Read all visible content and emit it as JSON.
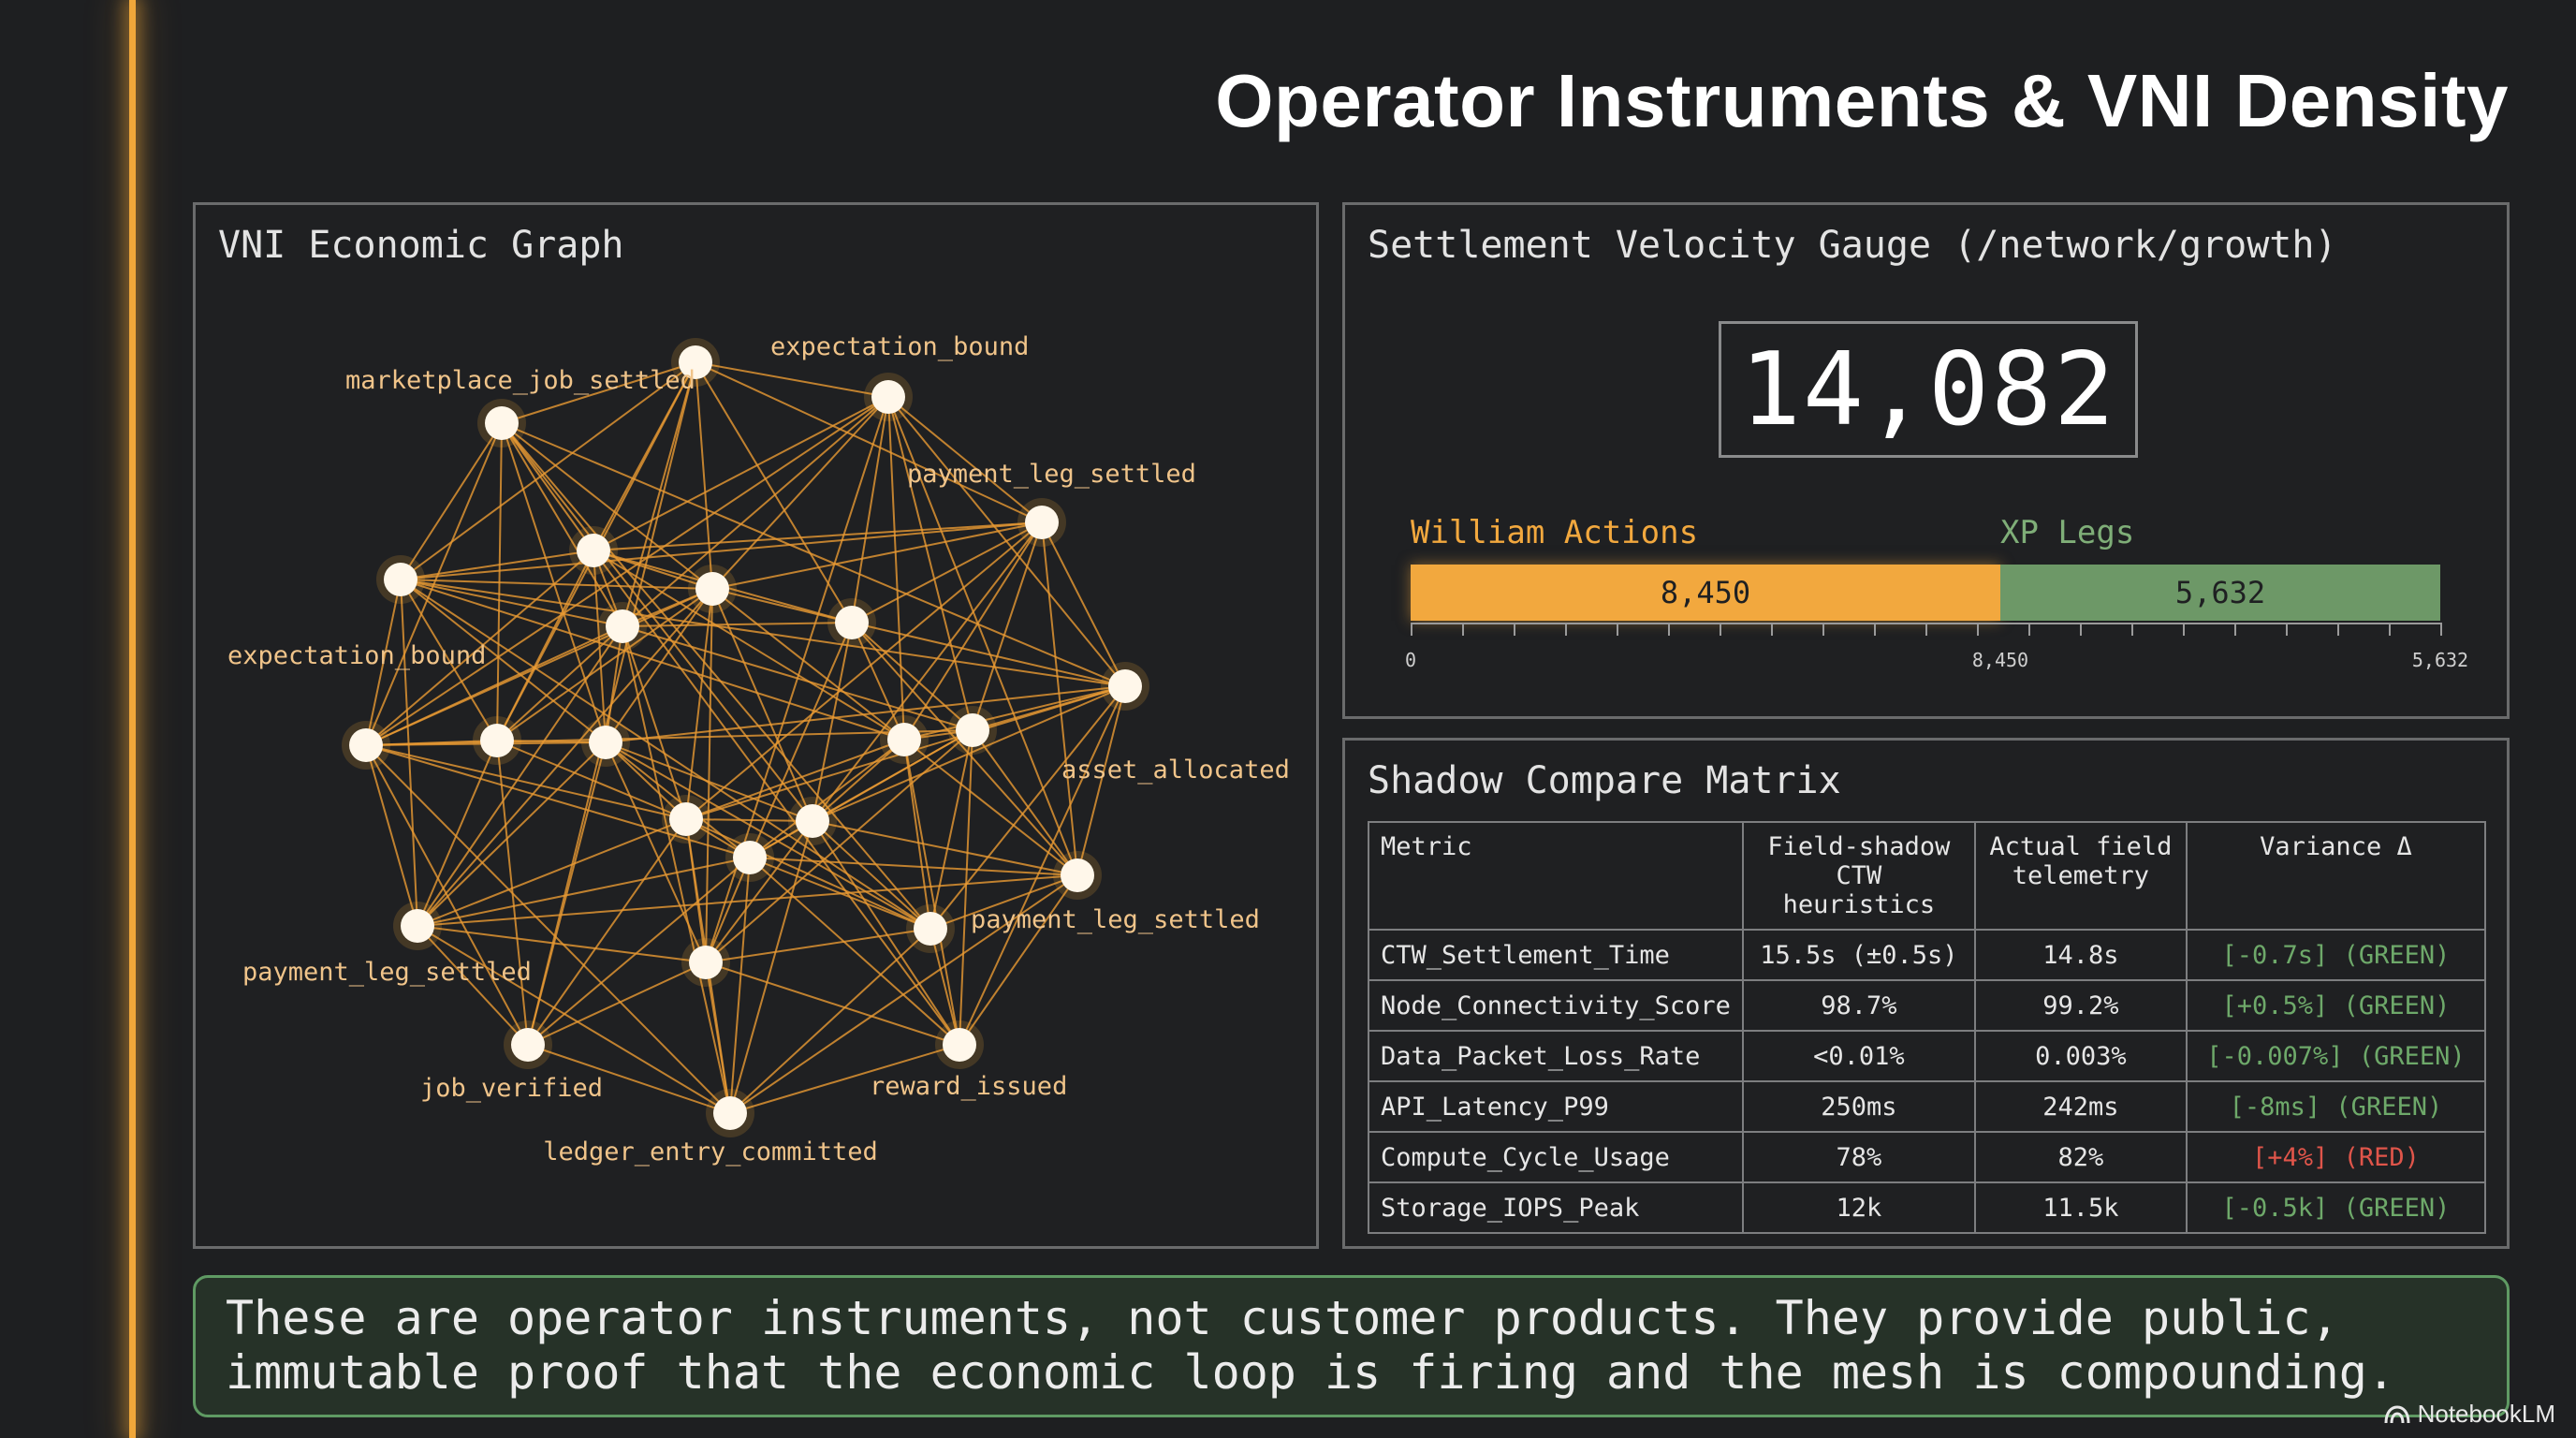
{
  "title": "Operator Instruments & VNI Density",
  "graph": {
    "title": "VNI Economic Graph",
    "labels": [
      "marketplace_job_settled",
      "expectation_bound",
      "payment_leg_settled",
      "expectation_bound",
      "asset_allocated",
      "payment_leg_settled",
      "payment_leg_settled",
      "job_verified",
      "reward_issued",
      "ledger_entry_committed"
    ]
  },
  "gauge": {
    "title": "Settlement Velocity Gauge (/network/growth)",
    "total": "14,082",
    "segments": [
      {
        "label": "William Actions",
        "display": "8,450",
        "value": 8450,
        "color": "#f2a83e"
      },
      {
        "label": "XP Legs",
        "display": "5,632",
        "value": 5632,
        "color": "#6d9867"
      }
    ],
    "axis_labels": [
      "0",
      "8,450",
      "5,632"
    ]
  },
  "matrix": {
    "title": "Shadow Compare Matrix",
    "headers": [
      "Metric",
      "Field-shadow CTW heuristics",
      "Actual field telemetry",
      "Variance Δ"
    ],
    "rows": [
      {
        "metric": "CTW_Settlement_Time",
        "shadow": "15.5s (±0.5s)",
        "actual": "14.8s",
        "variance": "[-0.7s] (GREEN)",
        "status": "green"
      },
      {
        "metric": "Node_Connectivity_Score",
        "shadow": "98.7%",
        "actual": "99.2%",
        "variance": "[+0.5%] (GREEN)",
        "status": "green"
      },
      {
        "metric": "Data_Packet_Loss_Rate",
        "shadow": "<0.01%",
        "actual": "0.003%",
        "variance": "[-0.007%] (GREEN)",
        "status": "green"
      },
      {
        "metric": "API_Latency_P99",
        "shadow": "250ms",
        "actual": "242ms",
        "variance": "[-8ms] (GREEN)",
        "status": "green"
      },
      {
        "metric": "Compute_Cycle_Usage",
        "shadow": "78%",
        "actual": "82%",
        "variance": "[+4%] (RED)",
        "status": "red"
      },
      {
        "metric": "Storage_IOPS_Peak",
        "shadow": "12k",
        "actual": "11.5k",
        "variance": "[-0.5k] (GREEN)",
        "status": "green"
      }
    ]
  },
  "caption": {
    "line1": "These are operator instruments, not customer products. They provide public,",
    "line2": "immutable proof that the economic loop is firing and the mesh is compounding."
  },
  "brand": "NotebookLM",
  "colors": {
    "accent": "#f0a73a",
    "green": "#6ea96a",
    "red": "#e0554a"
  }
}
